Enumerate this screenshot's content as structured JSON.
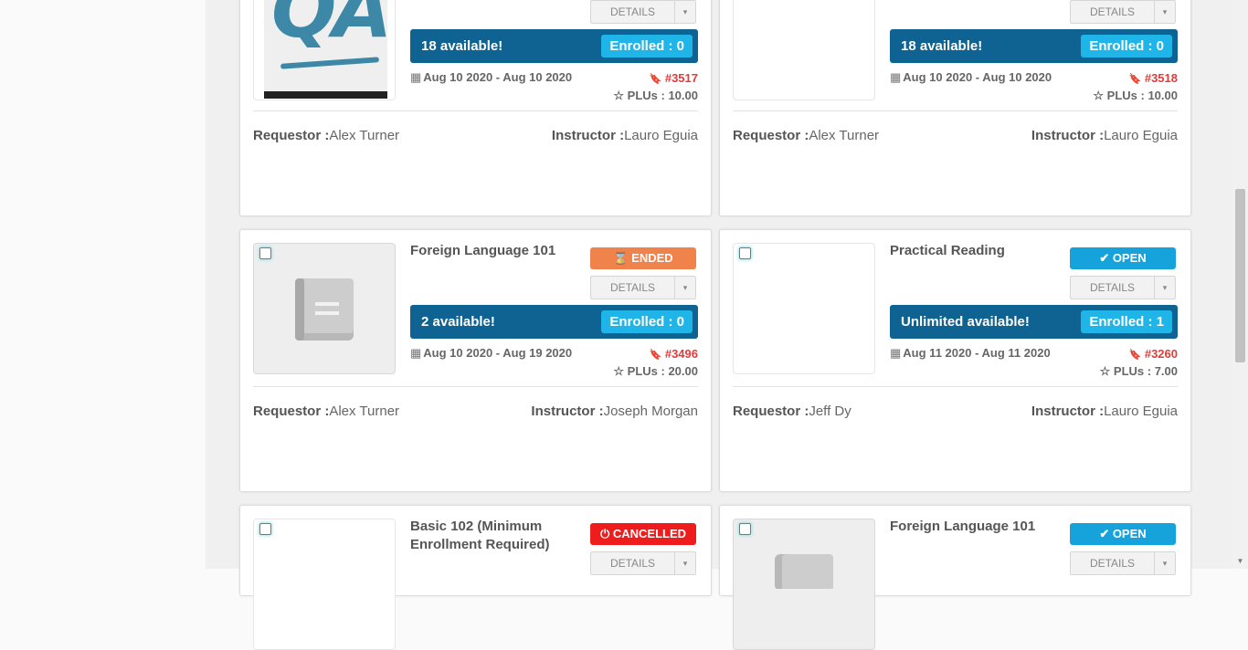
{
  "common": {
    "details_label": "DETAILS",
    "caret": "▾",
    "requestor_label": "Requestor :",
    "instructor_label": "Instructor :",
    "calendar_glyph": "▦",
    "bookmark_glyph": "🔖",
    "star_glyph": "☆",
    "scroll_down_glyph": "▼"
  },
  "thumbnail_text": "QA",
  "courses": [
    {
      "title": "",
      "status": "",
      "available": "18 available!",
      "enrolled": "Enrolled : 0",
      "dates": "Aug 10 2020 - Aug 10 2020",
      "code": "#3517",
      "plus": "PLUs : 10.00",
      "requestor": "Alex Turner",
      "instructor": "Lauro Eguia"
    },
    {
      "title": "",
      "status": "",
      "available": "18 available!",
      "enrolled": "Enrolled : 0",
      "dates": "Aug 10 2020 - Aug 10 2020",
      "code": "#3518",
      "plus": "PLUs : 10.00",
      "requestor": "Alex Turner",
      "instructor": "Lauro Eguia"
    },
    {
      "title": "Foreign Language 101",
      "status": "⌛ ENDED",
      "available": "2 available!",
      "enrolled": "Enrolled : 0",
      "dates": "Aug 10 2020 - Aug 19 2020",
      "code": "#3496",
      "plus": "PLUs : 20.00",
      "requestor": "Alex Turner",
      "instructor": "Joseph Morgan"
    },
    {
      "title": "Practical Reading",
      "status": "✔ OPEN",
      "available": "Unlimited available!",
      "enrolled": "Enrolled : 1",
      "dates": "Aug 11 2020 - Aug 11 2020",
      "code": "#3260",
      "plus": "PLUs : 7.00",
      "requestor": "Jeff Dy",
      "instructor": "Lauro Eguia"
    },
    {
      "title_line1": "Basic 102 (Minimum",
      "title_line2": "Enrollment Required)",
      "status": "⏻ CANCELLED"
    },
    {
      "title": "Foreign Language 101",
      "status": "✔ OPEN"
    }
  ],
  "colors": {
    "ended": "#f0824b",
    "open": "#16a3dc",
    "cancelled": "#ee1c1c",
    "available_bar": "#0e6392",
    "enrolled_pill": "#1fb5e8",
    "course_code": "#e23b3b"
  }
}
